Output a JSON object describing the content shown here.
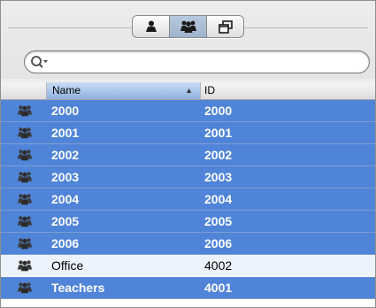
{
  "toolbar": {
    "view_buttons": [
      {
        "icon": "user-icon",
        "active": false
      },
      {
        "icon": "group-icon",
        "active": true
      },
      {
        "icon": "windows-icon",
        "active": false
      }
    ]
  },
  "search": {
    "value": "",
    "placeholder": "",
    "icon": "search-icon"
  },
  "table": {
    "columns": [
      {
        "key": "icon",
        "label": ""
      },
      {
        "key": "name",
        "label": "Name",
        "sorted": "ascending"
      },
      {
        "key": "id",
        "label": "ID"
      }
    ],
    "rows": [
      {
        "name": "2000",
        "id": "2000",
        "selected": true
      },
      {
        "name": "2001",
        "id": "2001",
        "selected": true
      },
      {
        "name": "2002",
        "id": "2002",
        "selected": true
      },
      {
        "name": "2003",
        "id": "2003",
        "selected": true
      },
      {
        "name": "2004",
        "id": "2004",
        "selected": true
      },
      {
        "name": "2005",
        "id": "2005",
        "selected": true
      },
      {
        "name": "2006",
        "id": "2006",
        "selected": true
      },
      {
        "name": "Office",
        "id": "4002",
        "selected": false
      },
      {
        "name": "Teachers",
        "id": "4001",
        "selected": true
      }
    ]
  },
  "colors": {
    "selection": "#4f84d8",
    "header_sorted": "#8fb1e0",
    "alternate_row": "#edf3fd"
  }
}
